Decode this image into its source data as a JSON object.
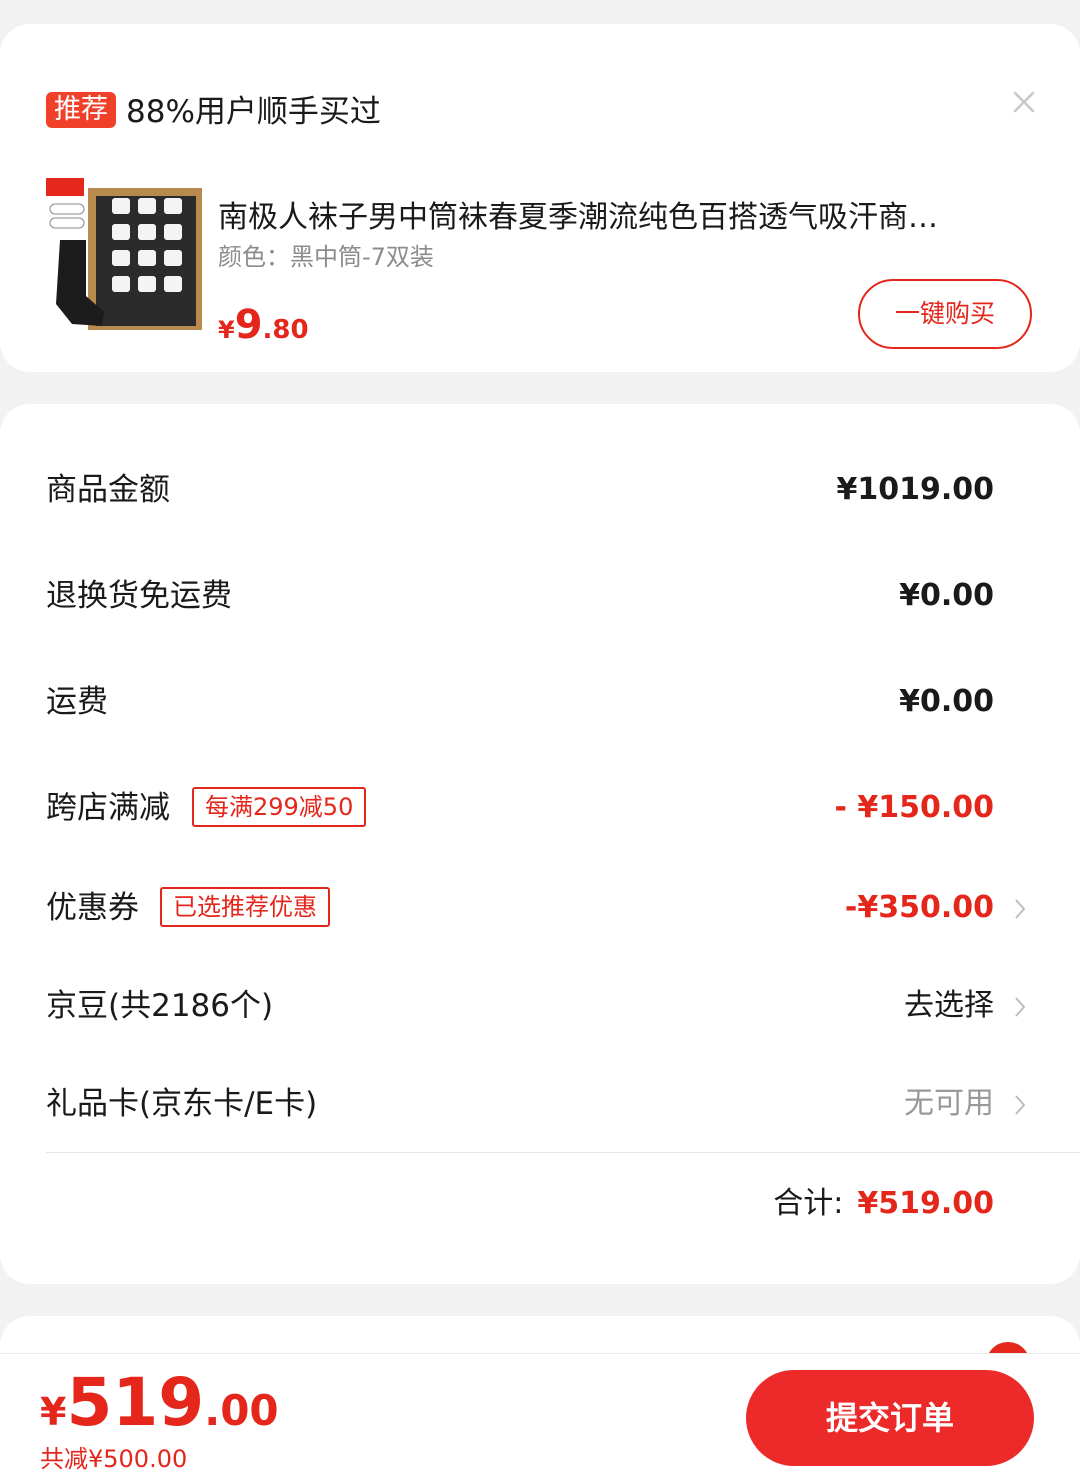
{
  "recommend": {
    "tag": "推荐",
    "title": "88%用户顺手买过",
    "product": {
      "image_brand": "南极人",
      "name": "南极人袜子男中筒袜春夏季潮流纯色百搭透气吸汗商…",
      "spec": "颜色：黑中筒-7双装",
      "price_symbol": "¥",
      "price_int": "9",
      "price_dec": ".80",
      "buy_label": "一键购买"
    }
  },
  "summary": {
    "rows": [
      {
        "label": "商品金额",
        "value": "¥1019.00"
      },
      {
        "label": "退换货免运费",
        "value": "¥0.00"
      },
      {
        "label": "运费",
        "value": "¥0.00"
      },
      {
        "label": "跨店满减",
        "tag": "每满299减50",
        "value": "- ¥150.00"
      },
      {
        "label": "优惠券",
        "tag": "已选推荐优惠",
        "value": "-¥350.00"
      },
      {
        "label": "京豆(共2186个)",
        "value": "去选择"
      },
      {
        "label": "礼品卡(京东卡/E卡)",
        "value": "无可用"
      }
    ],
    "total_label": "合计:",
    "total_value": "¥519.00"
  },
  "bottom": {
    "price_symbol": "¥",
    "price_int": "519",
    "price_dec": ".00",
    "saved": "共减¥500.00",
    "submit_label": "提交订单"
  },
  "colors": {
    "accent": "#e4261b",
    "button": "#ec2a2a",
    "background": "#f2f2f2"
  }
}
